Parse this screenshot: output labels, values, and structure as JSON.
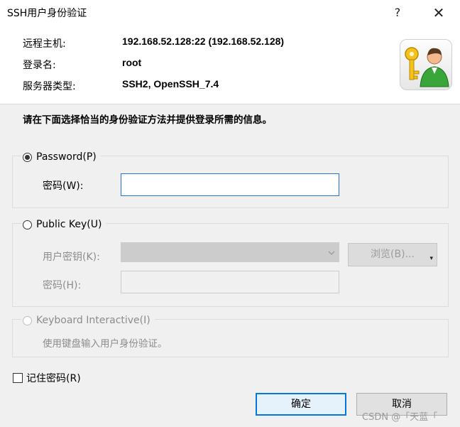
{
  "window": {
    "title": "SSH用户身份验证",
    "help_glyph": "?",
    "close_glyph": "✕"
  },
  "info": {
    "host_label": "远程主机:",
    "host_value": "192.168.52.128:22 (192.168.52.128)",
    "login_label": "登录名:",
    "login_value": "root",
    "server_label": "服务器类型:",
    "server_value": "SSH2, OpenSSH_7.4"
  },
  "instruction": "请在下面选择恰当的身份验证方法并提供登录所需的信息。",
  "password_method": {
    "label": "Password(P)",
    "selected": true,
    "field_label": "密码(W):",
    "value": ""
  },
  "pubkey_method": {
    "label": "Public Key(U)",
    "selected": false,
    "key_label": "用户密钥(K):",
    "key_value": "",
    "browse_label": "浏览(B)...",
    "pass_label": "密码(H):",
    "pass_value": ""
  },
  "keyboard_method": {
    "label": "Keyboard Interactive(I)",
    "selected": false,
    "description": "使用键盘输入用户身份验证。"
  },
  "remember": {
    "label": "记住密码(R)",
    "checked": false
  },
  "buttons": {
    "ok": "确定",
    "cancel": "取消"
  },
  "watermark": "CSDN @「天蓝「",
  "icons": [
    "key-user-icon",
    "help-icon",
    "close-icon",
    "dropdown-arrow-icon"
  ]
}
